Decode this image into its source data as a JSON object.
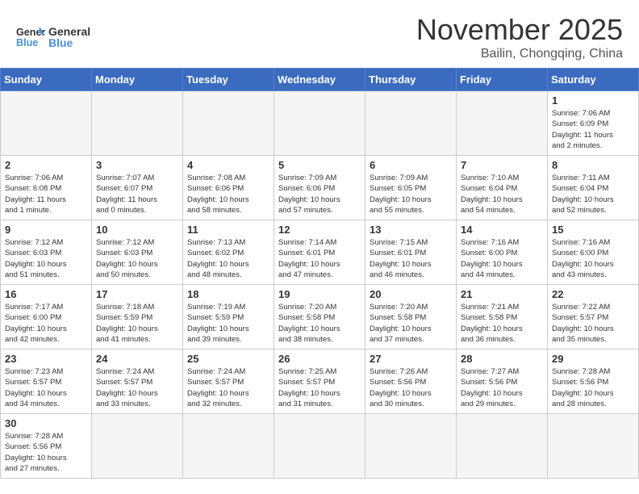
{
  "header": {
    "logo_general": "General",
    "logo_blue": "Blue",
    "month_title": "November 2025",
    "location": "Bailin, Chongqing, China"
  },
  "days_of_week": [
    "Sunday",
    "Monday",
    "Tuesday",
    "Wednesday",
    "Thursday",
    "Friday",
    "Saturday"
  ],
  "weeks": [
    [
      {
        "day": "",
        "info": ""
      },
      {
        "day": "",
        "info": ""
      },
      {
        "day": "",
        "info": ""
      },
      {
        "day": "",
        "info": ""
      },
      {
        "day": "",
        "info": ""
      },
      {
        "day": "",
        "info": ""
      },
      {
        "day": "1",
        "info": "Sunrise: 7:06 AM\nSunset: 6:09 PM\nDaylight: 11 hours\nand 2 minutes."
      }
    ],
    [
      {
        "day": "2",
        "info": "Sunrise: 7:06 AM\nSunset: 6:08 PM\nDaylight: 11 hours\nand 1 minute."
      },
      {
        "day": "3",
        "info": "Sunrise: 7:07 AM\nSunset: 6:07 PM\nDaylight: 11 hours\nand 0 minutes."
      },
      {
        "day": "4",
        "info": "Sunrise: 7:08 AM\nSunset: 6:06 PM\nDaylight: 10 hours\nand 58 minutes."
      },
      {
        "day": "5",
        "info": "Sunrise: 7:09 AM\nSunset: 6:06 PM\nDaylight: 10 hours\nand 57 minutes."
      },
      {
        "day": "6",
        "info": "Sunrise: 7:09 AM\nSunset: 6:05 PM\nDaylight: 10 hours\nand 55 minutes."
      },
      {
        "day": "7",
        "info": "Sunrise: 7:10 AM\nSunset: 6:04 PM\nDaylight: 10 hours\nand 54 minutes."
      },
      {
        "day": "8",
        "info": "Sunrise: 7:11 AM\nSunset: 6:04 PM\nDaylight: 10 hours\nand 52 minutes."
      }
    ],
    [
      {
        "day": "9",
        "info": "Sunrise: 7:12 AM\nSunset: 6:03 PM\nDaylight: 10 hours\nand 51 minutes."
      },
      {
        "day": "10",
        "info": "Sunrise: 7:12 AM\nSunset: 6:03 PM\nDaylight: 10 hours\nand 50 minutes."
      },
      {
        "day": "11",
        "info": "Sunrise: 7:13 AM\nSunset: 6:02 PM\nDaylight: 10 hours\nand 48 minutes."
      },
      {
        "day": "12",
        "info": "Sunrise: 7:14 AM\nSunset: 6:01 PM\nDaylight: 10 hours\nand 47 minutes."
      },
      {
        "day": "13",
        "info": "Sunrise: 7:15 AM\nSunset: 6:01 PM\nDaylight: 10 hours\nand 46 minutes."
      },
      {
        "day": "14",
        "info": "Sunrise: 7:16 AM\nSunset: 6:00 PM\nDaylight: 10 hours\nand 44 minutes."
      },
      {
        "day": "15",
        "info": "Sunrise: 7:16 AM\nSunset: 6:00 PM\nDaylight: 10 hours\nand 43 minutes."
      }
    ],
    [
      {
        "day": "16",
        "info": "Sunrise: 7:17 AM\nSunset: 6:00 PM\nDaylight: 10 hours\nand 42 minutes."
      },
      {
        "day": "17",
        "info": "Sunrise: 7:18 AM\nSunset: 5:59 PM\nDaylight: 10 hours\nand 41 minutes."
      },
      {
        "day": "18",
        "info": "Sunrise: 7:19 AM\nSunset: 5:59 PM\nDaylight: 10 hours\nand 39 minutes."
      },
      {
        "day": "19",
        "info": "Sunrise: 7:20 AM\nSunset: 5:58 PM\nDaylight: 10 hours\nand 38 minutes."
      },
      {
        "day": "20",
        "info": "Sunrise: 7:20 AM\nSunset: 5:58 PM\nDaylight: 10 hours\nand 37 minutes."
      },
      {
        "day": "21",
        "info": "Sunrise: 7:21 AM\nSunset: 5:58 PM\nDaylight: 10 hours\nand 36 minutes."
      },
      {
        "day": "22",
        "info": "Sunrise: 7:22 AM\nSunset: 5:57 PM\nDaylight: 10 hours\nand 35 minutes."
      }
    ],
    [
      {
        "day": "23",
        "info": "Sunrise: 7:23 AM\nSunset: 5:57 PM\nDaylight: 10 hours\nand 34 minutes."
      },
      {
        "day": "24",
        "info": "Sunrise: 7:24 AM\nSunset: 5:57 PM\nDaylight: 10 hours\nand 33 minutes."
      },
      {
        "day": "25",
        "info": "Sunrise: 7:24 AM\nSunset: 5:57 PM\nDaylight: 10 hours\nand 32 minutes."
      },
      {
        "day": "26",
        "info": "Sunrise: 7:25 AM\nSunset: 5:57 PM\nDaylight: 10 hours\nand 31 minutes."
      },
      {
        "day": "27",
        "info": "Sunrise: 7:26 AM\nSunset: 5:56 PM\nDaylight: 10 hours\nand 30 minutes."
      },
      {
        "day": "28",
        "info": "Sunrise: 7:27 AM\nSunset: 5:56 PM\nDaylight: 10 hours\nand 29 minutes."
      },
      {
        "day": "29",
        "info": "Sunrise: 7:28 AM\nSunset: 5:56 PM\nDaylight: 10 hours\nand 28 minutes."
      }
    ],
    [
      {
        "day": "30",
        "info": "Sunrise: 7:28 AM\nSunset: 5:56 PM\nDaylight: 10 hours\nand 27 minutes."
      },
      {
        "day": "",
        "info": ""
      },
      {
        "day": "",
        "info": ""
      },
      {
        "day": "",
        "info": ""
      },
      {
        "day": "",
        "info": ""
      },
      {
        "day": "",
        "info": ""
      },
      {
        "day": "",
        "info": ""
      }
    ]
  ]
}
